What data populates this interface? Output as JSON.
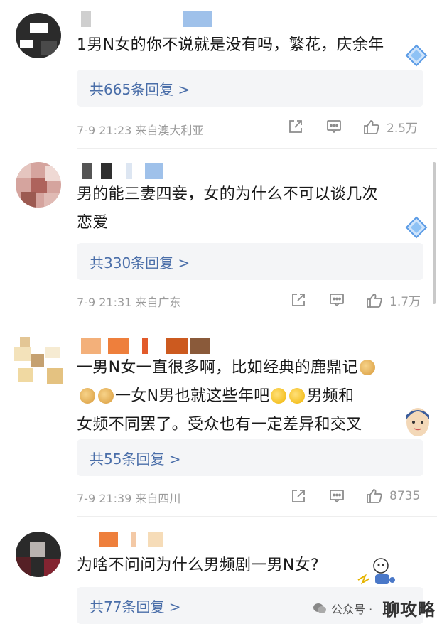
{
  "comments": [
    {
      "text": "1男N女的你不说就是没有吗，繁花，庆余年",
      "replies": "共665条回复 >",
      "time_loc": "7-9 21:23  来自澳大利亚",
      "likes": "2.5万"
    },
    {
      "text_line1": "男的能三妻四妾，女的为什么不可以谈几次",
      "text_line2": "恋爱",
      "replies": "共330条回复 >",
      "time_loc": "7-9 21:31  来自广东",
      "likes": "1.7万"
    },
    {
      "text_line1": "一男N女一直很多啊，比如经典的鹿鼎记",
      "text_line2b": "一女N男也就这些年吧",
      "text_line2c": "男频和",
      "text_line3": "女频不同罢了。受众也有一定差异和交叉",
      "replies": "共55条回复 >",
      "time_loc": "7-9 21:39  来自四川",
      "likes": "8735"
    },
    {
      "text": "为啥不问问为什么男频剧一男N女?",
      "replies": "共77条回复 >"
    }
  ],
  "watermark": {
    "source": "公众号 ·",
    "name": "聊攻略"
  },
  "icons": {
    "share": "share-icon",
    "comment": "comment-icon",
    "like": "thumb-up-icon"
  },
  "colors": {
    "link": "#4a6ea9",
    "meta": "#9b9b9b",
    "reply_bg": "#f4f5f7"
  }
}
